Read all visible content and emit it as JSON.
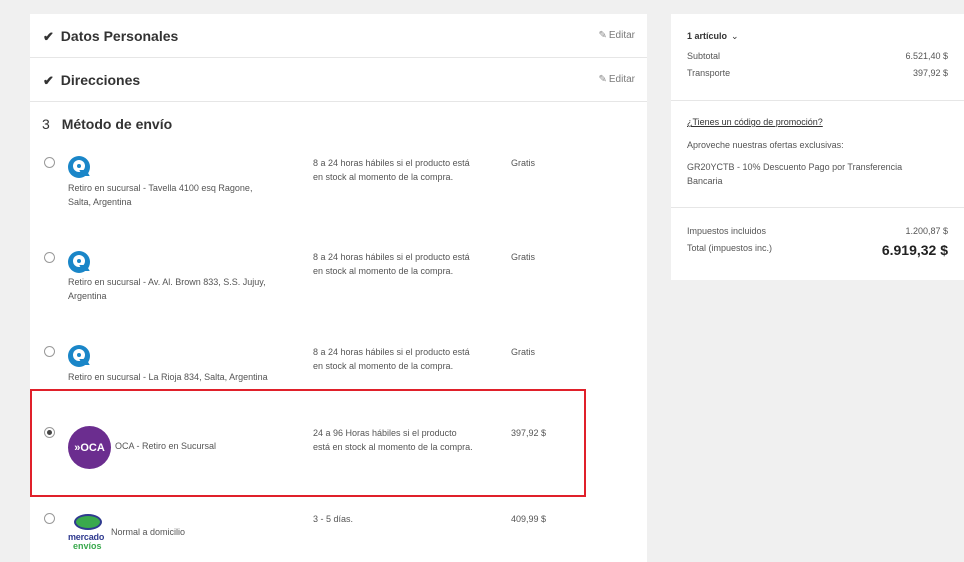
{
  "checkout": {
    "personal": {
      "check": "✔",
      "title": "Datos Personales",
      "edit": "Editar"
    },
    "address": {
      "check": "✔",
      "title": "Direcciones",
      "edit": "Editar"
    },
    "shipping": {
      "number": "3",
      "title": "Método de envío",
      "options": [
        {
          "name_line1": "Retiro en sucursal - Tavella 4100 esq Ragone,",
          "name_line2": "Salta, Argentina",
          "desc_line1": "8 a 24 horas hábiles si el producto está",
          "desc_line2": "en stock al momento de la compra.",
          "price": "Gratis",
          "selected": false,
          "logo": "andreani-logo"
        },
        {
          "name_line1": "Retiro en sucursal - Av. Al. Brown 833, S.S. Jujuy,",
          "name_line2": "Argentina",
          "desc_line1": "8 a 24 horas hábiles si el producto está",
          "desc_line2": "en stock al momento de la compra.",
          "price": "Gratis",
          "selected": false,
          "logo": "andreani-logo"
        },
        {
          "name_line1": "Retiro en sucursal - La Rioja 834, Salta, Argentina",
          "name_line2": "",
          "desc_line1": "8 a 24 horas hábiles si el producto está",
          "desc_line2": "en stock al momento de la compra.",
          "price": "Gratis",
          "selected": false,
          "logo": "andreani-logo"
        },
        {
          "name_line1": "OCA - Retiro en Sucursal",
          "name_line2": "",
          "desc_line1": "24 a 96 Horas hábiles si el producto",
          "desc_line2": "está en stock al momento de la compra.",
          "price": "397,92 $",
          "selected": true,
          "logo": "oca-logo",
          "logo_text": "»OCA"
        },
        {
          "name_line1": "Normal a domicilio",
          "name_line2": "",
          "desc_line1": "3 - 5 días.",
          "desc_line2": "",
          "price": "409,99 $",
          "selected": false,
          "logo": "mercado-envios-logo",
          "logo_text1": "mercado",
          "logo_text2": "envíos"
        }
      ]
    }
  },
  "summary": {
    "items_count": "1 artículo",
    "chevron": "⌄",
    "subtotal_label": "Subtotal",
    "subtotal_value": "6.521,40 $",
    "shipping_label": "Transporte",
    "shipping_value": "397,92 $",
    "promo_link": "¿Tienes un código de promoción?",
    "promo_intro": "Aproveche nuestras ofertas exclusivas:",
    "promo_offer_line1": "GR20YCTB - 10% Descuento Pago por Transferencia",
    "promo_offer_line2": "Bancaria",
    "taxes_label": "Impuestos incluidos",
    "taxes_value": "1.200,87 $",
    "total_label": "Total (impuestos inc.)",
    "total_value": "6.919,32 $"
  }
}
